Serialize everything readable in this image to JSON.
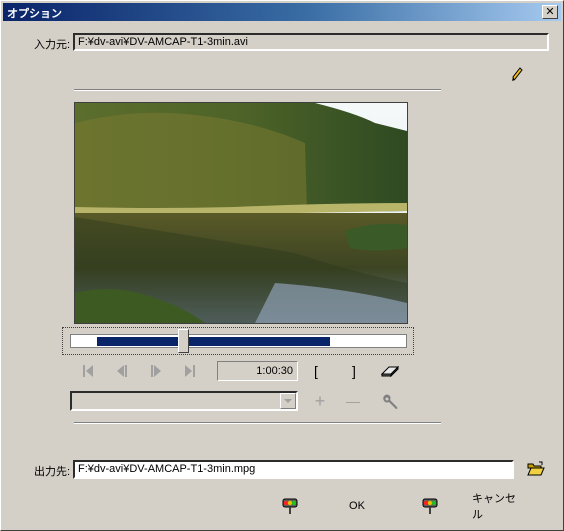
{
  "window": {
    "title": "オプション",
    "close_symbol": "✕"
  },
  "input": {
    "label": "入力元:",
    "value": "F:¥dv-avi¥DV-AMCAP-T1-3min.avi"
  },
  "player": {
    "time": "1:00:30",
    "mark_in": "[",
    "mark_out": "]",
    "add_symbol": "+",
    "remove_symbol": "—"
  },
  "output": {
    "label": "出力先:",
    "value": "F:¥dv-avi¥DV-AMCAP-T1-3min.mpg"
  },
  "buttons": {
    "ok": "OK",
    "cancel": "キャンセル"
  },
  "icons": [
    "pencil-icon",
    "skip-start-icon",
    "step-back-icon",
    "step-forward-icon",
    "skip-end-icon",
    "eraser-icon",
    "wrench-icon",
    "folder-open-icon",
    "traffic-light-icon"
  ]
}
